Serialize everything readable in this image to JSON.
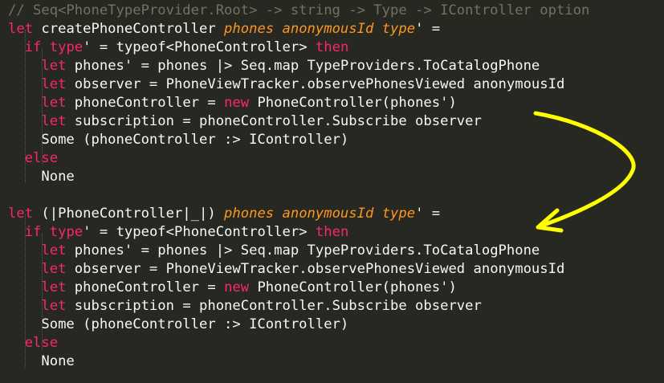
{
  "editor": {
    "lines": [
      [
        {
          "t": "// Seq<PhoneTypeProvider.Root> -> string -> Type -> IController option",
          "c": "comment"
        }
      ],
      [
        {
          "t": "let",
          "c": "kw"
        },
        {
          "t": " createPhoneController ",
          "c": "plain"
        },
        {
          "t": "phones",
          "c": "param"
        },
        {
          "t": " ",
          "c": "plain"
        },
        {
          "t": "anonymousId",
          "c": "param"
        },
        {
          "t": " ",
          "c": "plain"
        },
        {
          "t": "type",
          "c": "param"
        },
        {
          "t": "' =",
          "c": "plain"
        }
      ],
      [
        {
          "t": "  ",
          "c": "plain"
        },
        {
          "t": "if",
          "c": "kw"
        },
        {
          "t": " ",
          "c": "plain"
        },
        {
          "t": "type",
          "c": "kw"
        },
        {
          "t": "' = typeof<PhoneController> ",
          "c": "plain"
        },
        {
          "t": "then",
          "c": "kw"
        }
      ],
      [
        {
          "t": "    ",
          "c": "plain"
        },
        {
          "t": "let",
          "c": "kw"
        },
        {
          "t": " phones' = phones |> Seq.map TypeProviders.ToCatalogPhone",
          "c": "plain"
        }
      ],
      [
        {
          "t": "    ",
          "c": "plain"
        },
        {
          "t": "let",
          "c": "kw"
        },
        {
          "t": " observer = PhoneViewTracker.observePhonesViewed anonymousId",
          "c": "plain"
        }
      ],
      [
        {
          "t": "    ",
          "c": "plain"
        },
        {
          "t": "let",
          "c": "kw"
        },
        {
          "t": " phoneController = ",
          "c": "plain"
        },
        {
          "t": "new",
          "c": "kw"
        },
        {
          "t": " PhoneController(phones')",
          "c": "plain"
        }
      ],
      [
        {
          "t": "    ",
          "c": "plain"
        },
        {
          "t": "let",
          "c": "kw"
        },
        {
          "t": " subscription = phoneController.Subscribe observer",
          "c": "plain"
        }
      ],
      [
        {
          "t": "    Some (phoneController :> IController)",
          "c": "plain"
        }
      ],
      [
        {
          "t": "  ",
          "c": "plain"
        },
        {
          "t": "else",
          "c": "kw"
        }
      ],
      [
        {
          "t": "    None",
          "c": "plain"
        }
      ],
      [],
      [
        {
          "t": "let",
          "c": "kw"
        },
        {
          "t": " (|PhoneController|_|) ",
          "c": "plain"
        },
        {
          "t": "phones",
          "c": "param"
        },
        {
          "t": " ",
          "c": "plain"
        },
        {
          "t": "anonymousId",
          "c": "param"
        },
        {
          "t": " ",
          "c": "plain"
        },
        {
          "t": "type",
          "c": "param"
        },
        {
          "t": "' =",
          "c": "plain"
        }
      ],
      [
        {
          "t": "  ",
          "c": "plain"
        },
        {
          "t": "if",
          "c": "kw"
        },
        {
          "t": " ",
          "c": "plain"
        },
        {
          "t": "type",
          "c": "kw"
        },
        {
          "t": "' = typeof<PhoneController> ",
          "c": "plain"
        },
        {
          "t": "then",
          "c": "kw"
        }
      ],
      [
        {
          "t": "    ",
          "c": "plain"
        },
        {
          "t": "let",
          "c": "kw"
        },
        {
          "t": " phones' = phones |> Seq.map TypeProviders.ToCatalogPhone",
          "c": "plain"
        }
      ],
      [
        {
          "t": "    ",
          "c": "plain"
        },
        {
          "t": "let",
          "c": "kw"
        },
        {
          "t": " observer = PhoneViewTracker.observePhonesViewed anonymousId",
          "c": "plain"
        }
      ],
      [
        {
          "t": "    ",
          "c": "plain"
        },
        {
          "t": "let",
          "c": "kw"
        },
        {
          "t": " phoneController = ",
          "c": "plain"
        },
        {
          "t": "new",
          "c": "kw"
        },
        {
          "t": " PhoneController(phones')",
          "c": "plain"
        }
      ],
      [
        {
          "t": "    ",
          "c": "plain"
        },
        {
          "t": "let",
          "c": "kw"
        },
        {
          "t": " subscription = phoneController.Subscribe observer",
          "c": "plain"
        }
      ],
      [
        {
          "t": "    Some (phoneController :> IController)",
          "c": "plain"
        }
      ],
      [
        {
          "t": "  ",
          "c": "plain"
        },
        {
          "t": "else",
          "c": "kw"
        }
      ],
      [
        {
          "t": "    None",
          "c": "plain"
        }
      ]
    ]
  },
  "colors": {
    "background": "#272822",
    "comment": "#75715e",
    "keyword": "#f92672",
    "parameter": "#fd971f",
    "plain": "#f8f8f2",
    "annotation_arrow": "#ffff00"
  },
  "annotation": {
    "icon": "curved-arrow-icon"
  }
}
